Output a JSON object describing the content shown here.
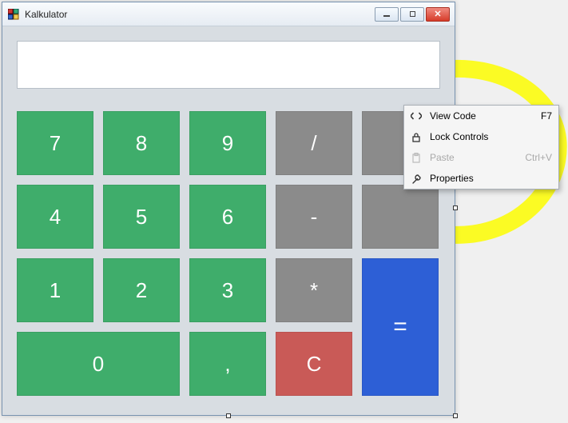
{
  "window": {
    "title": "Kalkulator"
  },
  "display": {
    "value": ""
  },
  "keys": {
    "k7": "7",
    "k8": "8",
    "k9": "9",
    "div": "/",
    "k4": "4",
    "k5": "5",
    "k6": "6",
    "sub": "-",
    "k1": "1",
    "k2": "2",
    "k3": "3",
    "mul": "*",
    "k0": "0",
    "comma": ",",
    "clear": "C",
    "eq": "="
  },
  "context_menu": {
    "items": [
      {
        "label": "View Code",
        "shortcut": "F7",
        "icon": "code-icon",
        "enabled": true
      },
      {
        "label": "Lock Controls",
        "shortcut": "",
        "icon": "lock-icon",
        "enabled": true
      },
      {
        "label": "Paste",
        "shortcut": "Ctrl+V",
        "icon": "paste-icon",
        "enabled": false
      },
      {
        "label": "Properties",
        "shortcut": "",
        "icon": "wrench-icon",
        "enabled": true
      }
    ]
  },
  "colors": {
    "green": "#3fad6b",
    "gray": "#8b8b8b",
    "red": "#c95a57",
    "blue": "#2d5fd6"
  }
}
